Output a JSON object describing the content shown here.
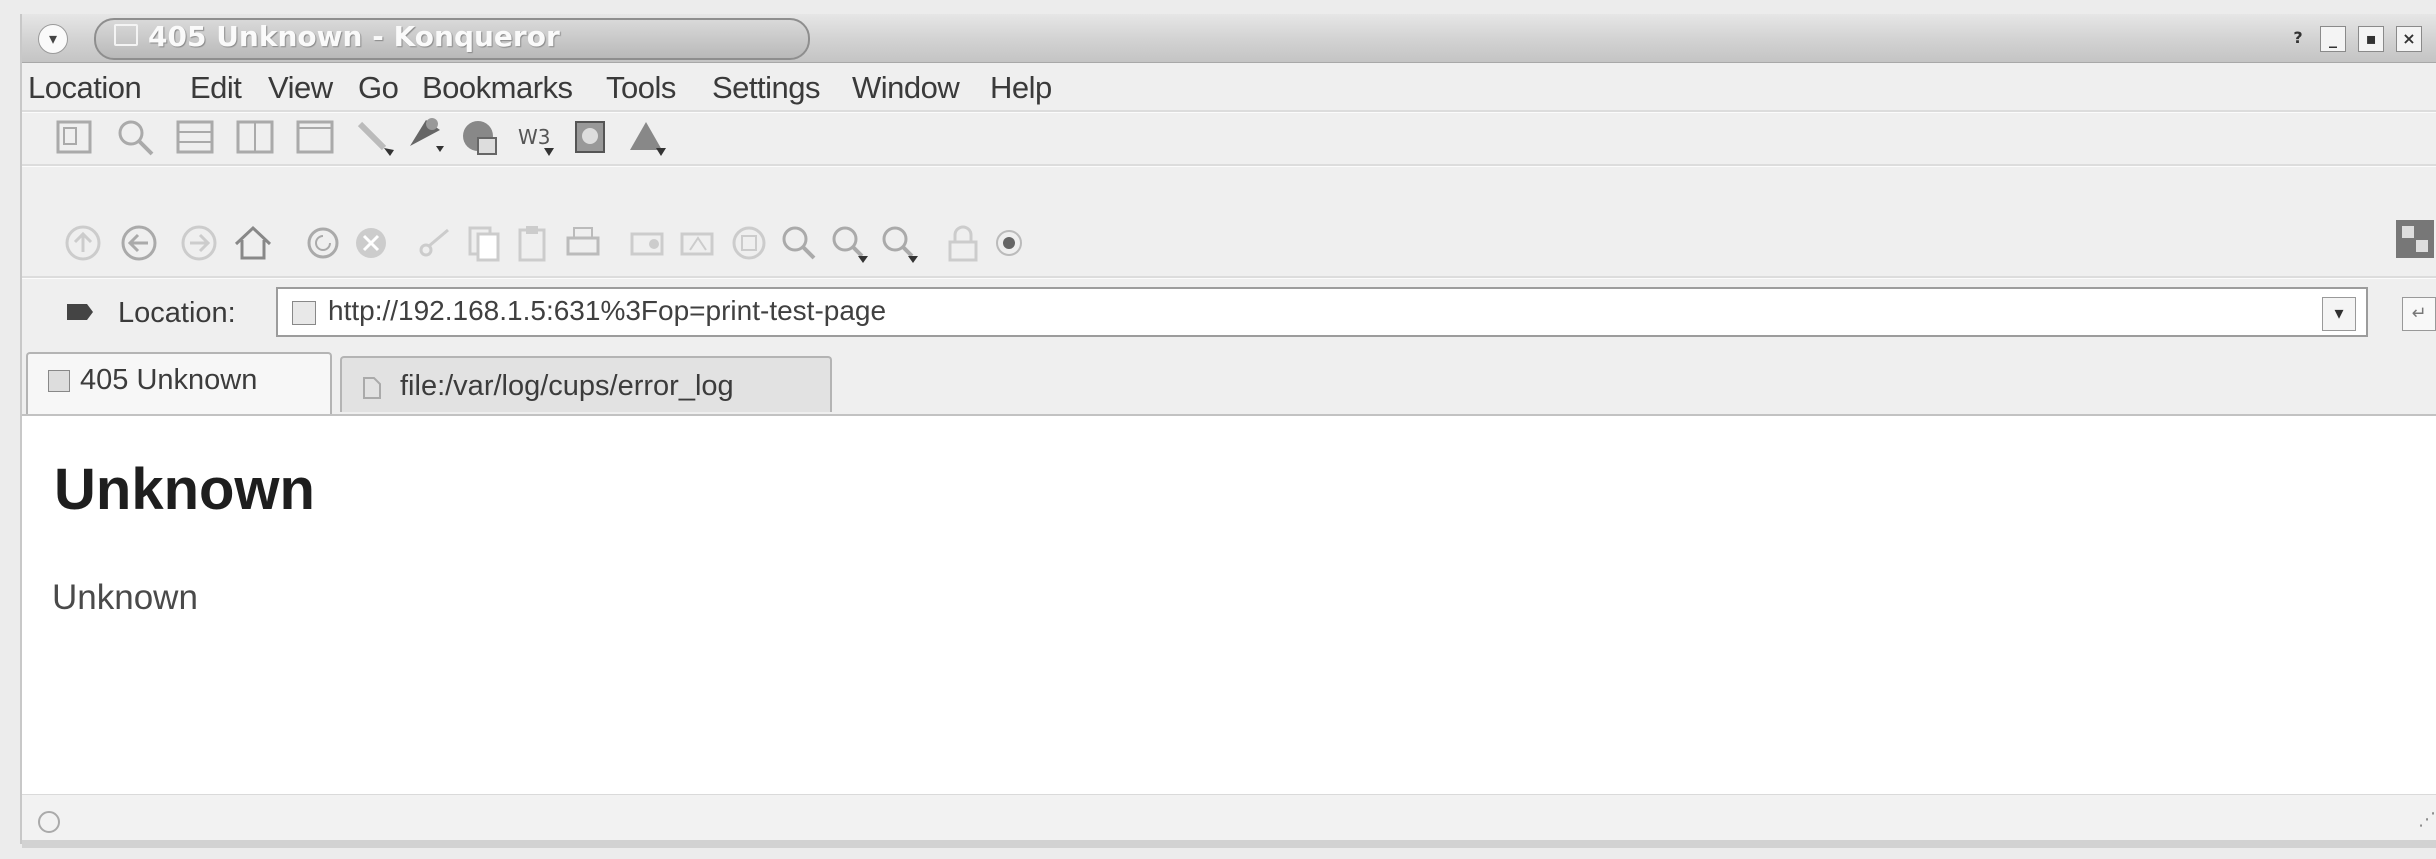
{
  "window": {
    "title": "405 Unknown - Konqueror",
    "controls": [
      "help",
      "minimize",
      "maximize",
      "close"
    ]
  },
  "menubar": {
    "items": [
      "Location",
      "Edit",
      "View",
      "Go",
      "Bookmarks",
      "Tools",
      "Settings",
      "Window",
      "Help"
    ]
  },
  "toolbar_top": {
    "icons": [
      "view-tree-icon",
      "find-icon",
      "split-horizontal-icon",
      "split-vertical-icon",
      "single-view-icon",
      "tools-icon",
      "kget-icon",
      "web-icon",
      "w3c-validator-icon",
      "babelfish-icon",
      "warning-icon"
    ]
  },
  "toolbar_nav": {
    "icons": [
      "up-icon",
      "back-icon",
      "forward-icon",
      "home-icon",
      "reload-icon",
      "stop-icon",
      "cut-icon",
      "copy-icon",
      "paste-icon",
      "print-icon",
      "increase-font-icon",
      "decrease-font-icon",
      "find-in-page-icon",
      "zoom-fit-icon",
      "zoom-in-icon",
      "zoom-out-icon",
      "security-lock-icon",
      "record-icon"
    ]
  },
  "location": {
    "label": "Location:",
    "url": "http://192.168.1.5:631%3Fop=print-test-page"
  },
  "tabs": [
    {
      "label": "405 Unknown",
      "active": true
    },
    {
      "label": "file:/var/log/cups/error_log",
      "active": false
    }
  ],
  "page": {
    "heading": "Unknown",
    "body": "Unknown"
  }
}
